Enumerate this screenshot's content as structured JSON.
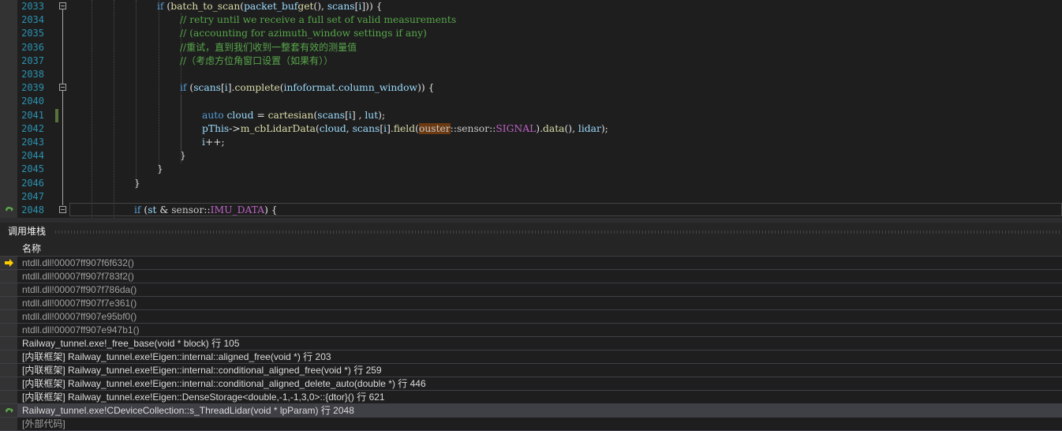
{
  "editor": {
    "line_numbers": [
      "2033",
      "2034",
      "2035",
      "2036",
      "2037",
      "2038",
      "2039",
      "2040",
      "2041",
      "2042",
      "2043",
      "2044",
      "2045",
      "2046",
      "2047",
      "2048"
    ],
    "code": {
      "l2033": {
        "kw_if": "if",
        "open": " (",
        "fn": "batch_to_scan",
        "p1": "(",
        "var1": "packet_buf",
        ".": ".",
        "fn2": "get",
        "p2": "(), ",
        "var2": "scans",
        "idx": "[",
        "var3": "i",
        "close": "])) {"
      },
      "l2034": "// retry until we receive a full set of valid measurements",
      "l2035": "// (accounting for azimuth_window settings if any)",
      "l2036": "//重试，直到我们收到一整套有效的测量值",
      "l2037": "//（考虑方位角窗口设置（如果有））",
      "l2039": {
        "kw_if": "if",
        "a": " (",
        "var1": "scans",
        "b": "[",
        "var2": "i",
        "c": "].",
        "fn": "complete",
        "d": "(",
        "var3": "info",
        ".": ".",
        "var4": "format",
        "e": ".",
        "var5": "column_window",
        "f": ")) {"
      },
      "l2041": {
        "kw": "auto",
        "sp": " ",
        "var1": "cloud",
        "eq": " = ",
        "fn": "cartesian",
        "a": "(",
        "var2": "scans",
        "b": "[",
        "var3": "i",
        "c": "] , ",
        "var4": "lut",
        "d": ");"
      },
      "l2042": {
        "var1": "pThis",
        "arrow": "->",
        "fn": "m_cbLidarData",
        "a": "(",
        "var2": "cloud",
        ",": ", ",
        "var3": "scans",
        "b": "[",
        "var4": "i",
        "c": "].",
        "fn2": "field",
        "d": "(",
        "ns1": "ouster",
        "sep1": "::",
        "ns2": "sensor",
        "sep2": "::",
        "macro": "SIGNAL",
        "e": ").",
        "fn3": "data",
        "f": "(), ",
        "var5": "lidar",
        "g": ");"
      },
      "l2043": {
        "var": "i",
        "op": "++;"
      },
      "l2044": "}",
      "l2045": "}",
      "l2046": "}",
      "l2048": {
        "kw_if": "if",
        "a": " (",
        "var1": "st",
        "b": " & ",
        "ns": "sensor",
        "sep": "::",
        "macro": "IMU_DATA",
        "c": ") {"
      }
    }
  },
  "call_stack": {
    "title": "调用堆栈",
    "column_header": "名称",
    "rows": [
      {
        "text": "ntdll.dll!00007ff907f6f632()",
        "marker": "current-instruction"
      },
      {
        "text": "ntdll.dll!00007ff907f783f2()"
      },
      {
        "text": "ntdll.dll!00007ff907f786da()"
      },
      {
        "text": "ntdll.dll!00007ff907f7e361()"
      },
      {
        "text": "ntdll.dll!00007ff907e95bf0()"
      },
      {
        "text": "ntdll.dll!00007ff907e947b1()"
      },
      {
        "text": "Railway_tunnel.exe!_free_base(void * block) 行 105"
      },
      {
        "text": "[内联框架] Railway_tunnel.exe!Eigen::internal::aligned_free(void *) 行 203"
      },
      {
        "text": "[内联框架] Railway_tunnel.exe!Eigen::internal::conditional_aligned_free(void *) 行 259"
      },
      {
        "text": "[内联框架] Railway_tunnel.exe!Eigen::internal::conditional_aligned_delete_auto(double *) 行 446"
      },
      {
        "text": "[内联框架] Railway_tunnel.exe!Eigen::DenseStorage<double,-1,-1,3,0>::{dtor}() 行 621"
      },
      {
        "text": "Railway_tunnel.exe!CDeviceCollection::s_ThreadLidar(void * lpParam) 行 2048",
        "marker": "call-return"
      },
      {
        "text": "[外部代码]"
      }
    ]
  },
  "colors": {
    "keyword": "#569cd6",
    "function": "#dcdcaa",
    "variable": "#9cdcfe",
    "comment": "#57a64a",
    "line_number": "#2b91af"
  },
  "icons": {
    "current_instruction": "yellow-arrow-icon",
    "call_return": "green-return-arrow-icon"
  }
}
